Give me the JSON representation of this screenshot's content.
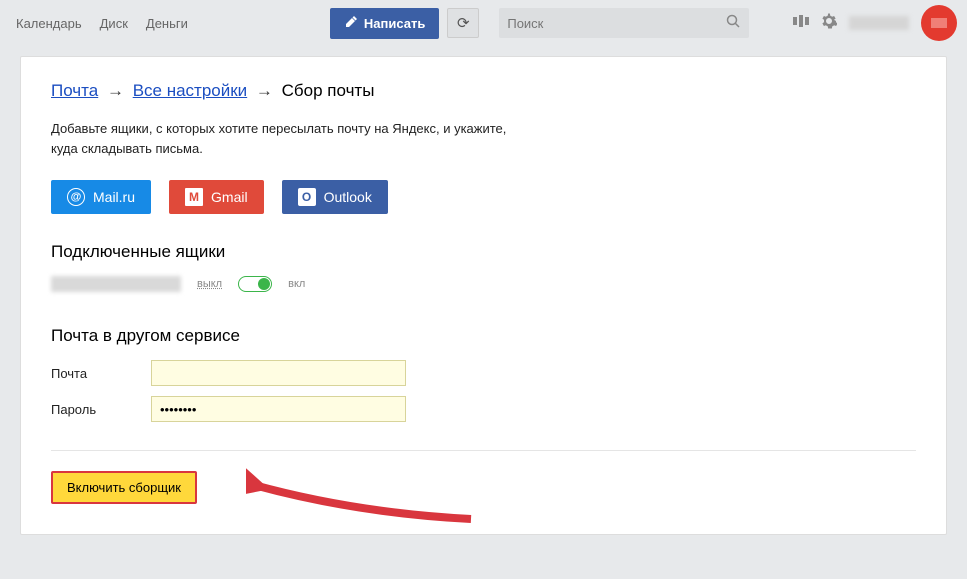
{
  "topbar": {
    "links": {
      "calendar": "Календарь",
      "disk": "Диск",
      "money": "Деньги"
    },
    "compose": "Написать",
    "search_placeholder": "Поиск"
  },
  "crumbs": {
    "mail": "Почта",
    "all_settings": "Все настройки",
    "current": "Сбор почты"
  },
  "lead": "Добавьте ящики, с которых хотите пересылать почту на Яндекс, и укажите, куда складывать письма.",
  "providers": {
    "mail": "Mail.ru",
    "gmail": "Gmail",
    "outlook": "Outlook"
  },
  "connected": {
    "title": "Подключенные ящики",
    "off": "выкл",
    "on": "вкл"
  },
  "form": {
    "title": "Почта в другом сервисе",
    "email_label": "Почта",
    "password_label": "Пароль",
    "password_value": "••••••••"
  },
  "submit": "Включить сборщик"
}
